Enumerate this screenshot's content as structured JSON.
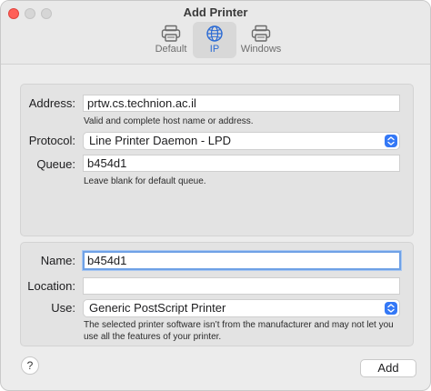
{
  "window": {
    "title": "Add Printer"
  },
  "toolbar": {
    "tabs": [
      {
        "label": "Default",
        "icon": "printer-icon",
        "selected": false
      },
      {
        "label": "IP",
        "icon": "globe-icon",
        "selected": true
      },
      {
        "label": "Windows",
        "icon": "printer-icon",
        "selected": false
      }
    ]
  },
  "connection": {
    "address": {
      "label": "Address:",
      "value": "prtw.cs.technion.ac.il",
      "hint": "Valid and complete host name or address."
    },
    "protocol": {
      "label": "Protocol:",
      "value": "Line Printer Daemon - LPD"
    },
    "queue": {
      "label": "Queue:",
      "value": "b454d1",
      "hint": "Leave blank for default queue."
    }
  },
  "details": {
    "name": {
      "label": "Name:",
      "value": "b454d1"
    },
    "location": {
      "label": "Location:",
      "value": ""
    },
    "use": {
      "label": "Use:",
      "value": "Generic PostScript Printer",
      "hint": "The selected printer software isn’t from the manufacturer and may not let you use all the features of your printer."
    }
  },
  "footer": {
    "help_label": "?",
    "add_label": "Add"
  },
  "colors": {
    "accent": "#3478f6",
    "focus_ring": "#6fa1e6",
    "close_button": "#ff5f57"
  }
}
